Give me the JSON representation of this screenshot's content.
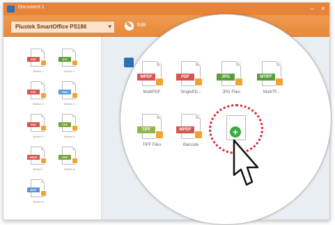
{
  "window": {
    "title": "Document 1",
    "minimize_label": "–",
    "close_label": "×",
    "title_color": "#e8833a"
  },
  "toolbar": {
    "profile_name": "Plustek SmartOffice PS186",
    "edit_label": "Edit"
  },
  "sidebar": {
    "items": [
      {
        "tag": "PDF",
        "color": "#d9534f",
        "label": "Button 1"
      },
      {
        "tag": "JPG",
        "color": "#5a9e3a",
        "label": "Button 2"
      },
      {
        "tag": "PDF",
        "color": "#d9534f",
        "label": "Button 3"
      },
      {
        "tag": "PNG",
        "color": "#5b9bd5",
        "label": "Button 4"
      },
      {
        "tag": "PDF",
        "color": "#d9534f",
        "label": "Button 5"
      },
      {
        "tag": "TIFF",
        "color": "#7aa23a",
        "label": "Button 6"
      },
      {
        "tag": "MPDF",
        "color": "#d9534f",
        "label": "Button 7"
      },
      {
        "tag": "TIFF",
        "color": "#7aa23a",
        "label": "Button 8"
      },
      {
        "tag": "BMP",
        "color": "#5b8fd5",
        "label": "Button 9"
      }
    ]
  },
  "magnified": {
    "items": [
      {
        "tag": "MPDF",
        "color": "#d9534f",
        "label": "MultiPDF"
      },
      {
        "tag": "PDF",
        "color": "#d9534f",
        "label": "SinglePD..."
      },
      {
        "tag": "JPG",
        "color": "#5a9e3a",
        "label": "JPG Files"
      },
      {
        "tag": "MTIFF",
        "color": "#5a9e3a",
        "label": "MultiTF..."
      },
      {
        "tag": "TIFF",
        "color": "#8fb84a",
        "label": "TIFF Files"
      },
      {
        "tag": "MPDF",
        "color": "#d9534f",
        "label": "Barcode"
      }
    ],
    "add_button": "+"
  }
}
